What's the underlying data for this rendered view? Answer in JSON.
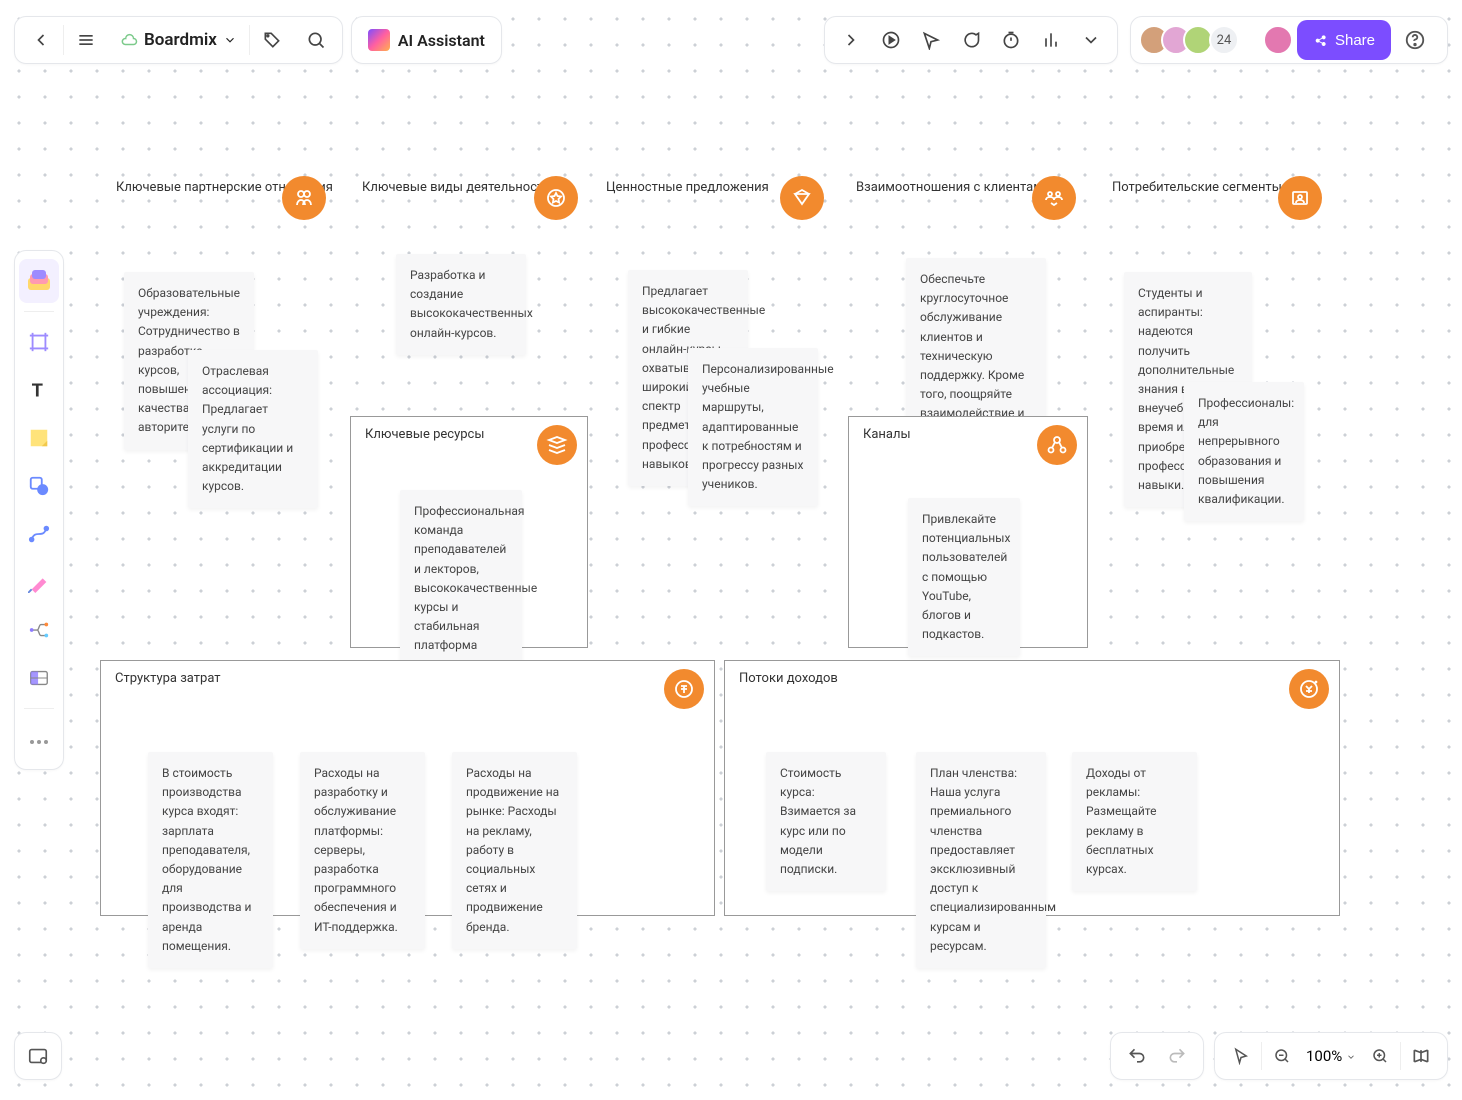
{
  "header": {
    "workspace_name": "Boardmix",
    "ai_label": "AI Assistant",
    "avatar_overflow": "24",
    "share_label": "Share"
  },
  "bottom": {
    "zoom": "100%"
  },
  "canvas": {
    "sections": {
      "partnerships": "Ключевые партнерские отношения",
      "activities": "Ключевые виды деятельности",
      "value": "Ценностные предложения",
      "relationships": "Взаимоотношения с клиентами",
      "segments": "Потребительские сегменты",
      "resources": "Ключевые ресурсы",
      "channels": "Каналы",
      "cost": "Структура затрат",
      "revenue": "Потоки доходов"
    },
    "notes": {
      "partnerships1": "Образовательные учреждения: Сотрудничество в разработке курсов, повышение их качества и авторитет",
      "partnerships2": "Отраслевая ассоциация: Предлагает услуги по сертификации и аккредитации курсов.",
      "activities1": "Разработка и создание высококачественных онлайн-курсов.",
      "value1": "Предлагает высококачественные и гибкие онлайн-курсы, охватывающие широкий спектр предметов и профессиональных навыков.",
      "value2": "Персонализированные учебные маршруты, адаптированные к потребностям и прогрессу разных учеников.",
      "relationships1": "Обеспечьте круглосуточное обслуживание клиентов и техническую поддержку. Кроме того, поощряйте взаимодействие и взаимопомощь пользователей с помощью форумов и групп в социальных сетях.",
      "segments1": "Студенты и аспиранты: надеются получить дополнительные знания во внеучебное время или приобрести профессиональные навыки.",
      "segments2": "Профессионалы: для непрерывного образования и повышения квалификации.",
      "resources1": "Профессиональная команда преподавателей и лекторов, высококачественные курсы и стабильная платформа онлайн-обучения.",
      "channels1": "Привлекайте потенциальных пользователей с помощью YouTube, блогов и подкастов.",
      "cost1": "В стоимость производства курса входят: зарплата преподавателя, оборудование для производства и аренда помещения.",
      "cost2": "Расходы на разработку и обслуживание платформы: серверы, разработка программного обеспечения и ИТ-поддержка.",
      "cost3": "Расходы на продвижение на рынке: Расходы на рекламу, работу в социальных сетях и продвижение бренда.",
      "revenue1": "Стоимость курса: Взимается за курс или по модели подписки.",
      "revenue2": "План членства: Наша услуга премиального членства предоставляет эксклюзивный доступ к специализированным курсам и ресурсам.",
      "revenue3": "Доходы от рекламы: Размещайте рекламу в бесплатных курсах."
    }
  }
}
